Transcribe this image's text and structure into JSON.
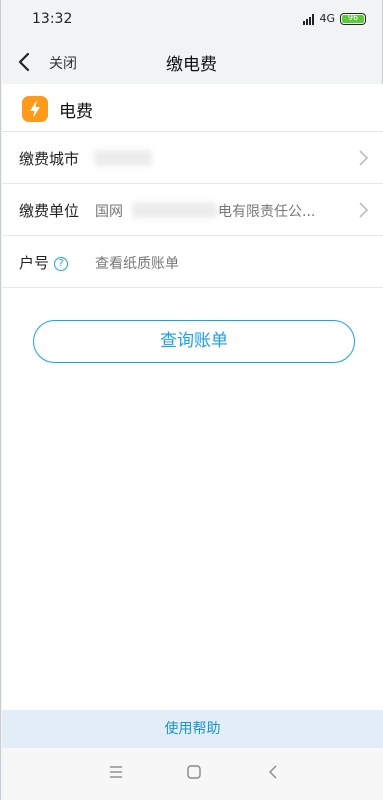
{
  "status": {
    "time": "13:32",
    "network": "4G",
    "battery": "96"
  },
  "nav": {
    "close_label": "关闭",
    "title": "缴电费"
  },
  "service": {
    "title": "电费"
  },
  "form": {
    "rows": [
      {
        "label": "缴费城市",
        "value": ""
      },
      {
        "label": "缴费单位",
        "value_prefix": "国网",
        "value_suffix": "电有限责任公..."
      },
      {
        "label": "户号",
        "placeholder": "查看纸质账单",
        "help": "?"
      }
    ]
  },
  "actions": {
    "query_label": "查询账单"
  },
  "footer": {
    "help_label": "使用帮助"
  },
  "colors": {
    "accent": "#1aa0f0",
    "bolt": "#ff9b1a"
  }
}
